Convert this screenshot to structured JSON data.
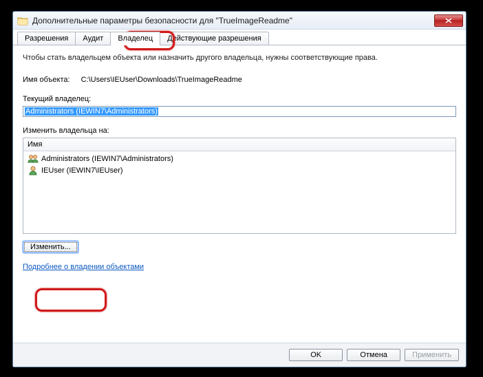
{
  "window": {
    "title": "Дополнительные параметры безопасности для \"TrueImageReadme\""
  },
  "tabs": {
    "permissions": "Разрешения",
    "audit": "Аудит",
    "owner": "Владелец",
    "effective": "Действующие разрешения"
  },
  "content": {
    "intro": "Чтобы стать владельцем объекта или назначить другого владельца, нужны соответствующие права.",
    "object_label": "Имя объекта:",
    "object_path": "C:\\Users\\IEUser\\Downloads\\TrueImageReadme",
    "current_owner_label": "Текущий владелец:",
    "current_owner_value": "Administrators (IEWIN7\\Administrators)",
    "change_owner_label": "Изменить владельца на:",
    "list_header": "Имя",
    "owners": [
      {
        "name": "Administrators (IEWIN7\\Administrators)",
        "icon": "group"
      },
      {
        "name": "IEUser (IEWIN7\\IEUser)",
        "icon": "user"
      }
    ],
    "edit_button": "Изменить...",
    "learn_more": "Подробнее о владении объектами"
  },
  "footer": {
    "ok": "OK",
    "cancel": "Отмена",
    "apply": "Применить"
  }
}
